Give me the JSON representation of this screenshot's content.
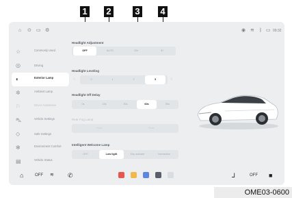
{
  "callouts": [
    "1",
    "2",
    "3",
    "4"
  ],
  "status_bar": {
    "time": "09:32",
    "left_icons": [
      "home-icon",
      "steering-icon",
      "display-icon",
      "settings-icon"
    ],
    "right_icons": [
      "location-icon",
      "wifi-icon",
      "bluetooth-icon",
      "battery-icon"
    ]
  },
  "sidebar": {
    "items": [
      {
        "label": "Commonly Used",
        "icon": "star-icon",
        "active": false,
        "dim": false
      },
      {
        "label": "Driving",
        "icon": "steering-wheel-icon",
        "active": false,
        "dim": false
      },
      {
        "label": "Exterior Lamp",
        "icon": "headlamp-icon",
        "active": true,
        "dim": false
      },
      {
        "label": "Ambient Lamp",
        "icon": "ambient-light-icon",
        "active": false,
        "dim": false
      },
      {
        "label": "Driver Assistance",
        "icon": "assist-icon",
        "active": false,
        "dim": true
      },
      {
        "label": "Vehicle Settings",
        "icon": "car-icon",
        "active": false,
        "dim": false
      },
      {
        "label": "Safe Settings",
        "icon": "shield-icon",
        "active": false,
        "dim": false
      },
      {
        "label": "Environment Comfort",
        "icon": "fan-icon",
        "active": false,
        "dim": false
      },
      {
        "label": "Vehicle Status",
        "icon": "status-icon",
        "active": false,
        "dim": false
      }
    ]
  },
  "main": {
    "headlight_adjustment": {
      "title": "Headlight Adjustment",
      "options": [
        "OFF",
        "AUTO",
        "ON",
        "ID"
      ],
      "selected": 0
    },
    "headlight_leveling": {
      "title": "Headlight Leveling",
      "options": [
        "0",
        "1",
        "2",
        "3"
      ],
      "selected": 3
    },
    "headlight_off_delay": {
      "title": "Headlight Off Delay",
      "options": [
        "0s",
        "15s",
        "30s",
        "60s",
        "90s"
      ],
      "selected": 3
    },
    "rear_fog_lamp": {
      "title": "Rear Fog Lamp",
      "options": [
        "Front",
        "Rear"
      ]
    },
    "welcome_lamp": {
      "title": "Intelligent Welcome Lamp",
      "options": [
        "OFF",
        "Low light",
        "Key activate",
        "Interactive"
      ],
      "selected": 1
    }
  },
  "bottom_bar": {
    "left_label": "OFF",
    "right_label": "OFF"
  },
  "figure_code": "OME03-0600"
}
